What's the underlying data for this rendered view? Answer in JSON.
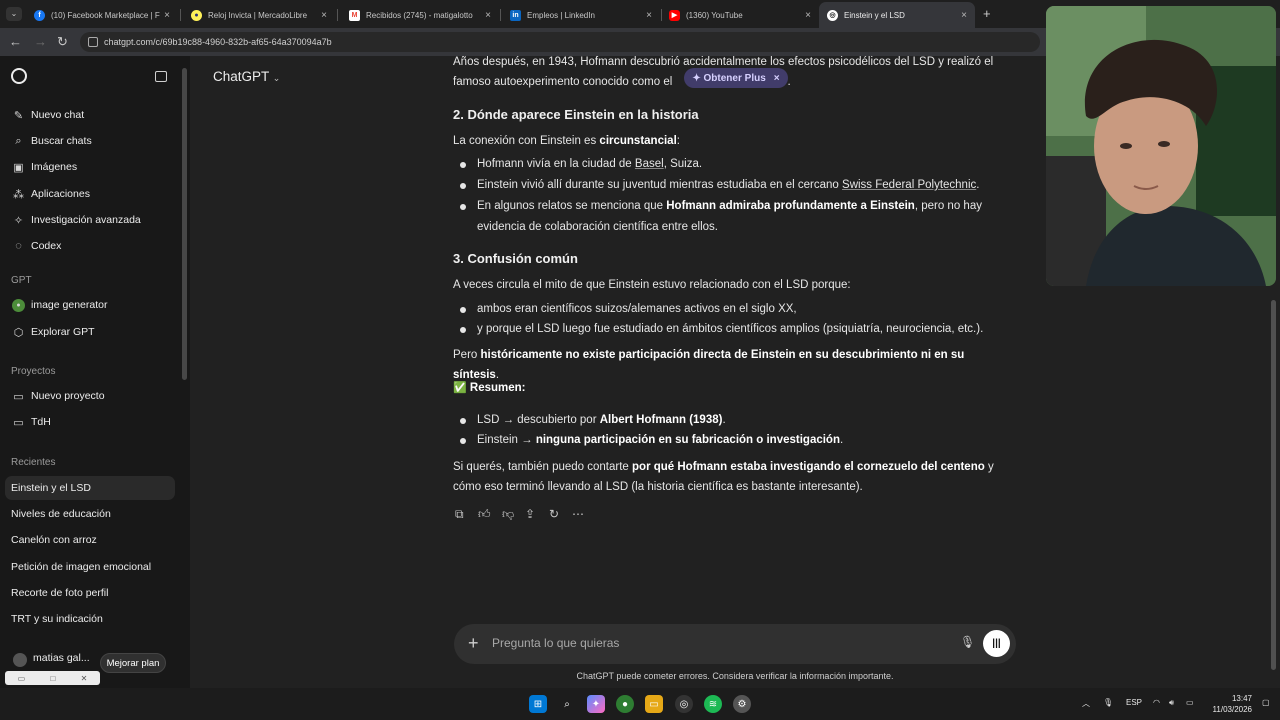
{
  "browser": {
    "tabs": [
      {
        "title": "(10) Facebook Marketplace | Fa",
        "icon": "facebook-icon",
        "color": "#1877f2",
        "glyph": "f"
      },
      {
        "title": "Reloj Invicta | MercadoLibre",
        "icon": "mercadolibre-icon",
        "color": "#fff159",
        "glyph": "●"
      },
      {
        "title": "Recibidos (2745) - matigalotto",
        "icon": "gmail-icon",
        "color": "#ea4335",
        "glyph": "M"
      },
      {
        "title": "Empleos | LinkedIn",
        "icon": "linkedin-icon",
        "color": "#0a66c2",
        "glyph": "in"
      },
      {
        "title": "(1360) YouTube",
        "icon": "youtube-icon",
        "color": "#ff0000",
        "glyph": "▶"
      },
      {
        "title": "Einstein y el LSD",
        "icon": "chatgpt-icon",
        "color": "#ffffff",
        "glyph": "◎"
      }
    ],
    "url": "chatgpt.com/c/69b19c88-4960-832b-af65-64a370094a7b"
  },
  "sidebar": {
    "menu": [
      {
        "label": "Nuevo chat",
        "icon": "edit-icon",
        "glyph": "✎"
      },
      {
        "label": "Buscar chats",
        "icon": "search-icon",
        "glyph": "⌕"
      },
      {
        "label": "Imágenes",
        "icon": "image-icon",
        "glyph": "▣"
      },
      {
        "label": "Aplicaciones",
        "icon": "apps-icon",
        "glyph": "⁂"
      },
      {
        "label": "Investigación avanzada",
        "icon": "research-icon",
        "glyph": "✧"
      },
      {
        "label": "Codex",
        "icon": "codex-icon",
        "glyph": "◌"
      }
    ],
    "gpt_heading": "GPT",
    "gpts": [
      {
        "label": "image generator",
        "icon": "image-generator-icon",
        "glyph": "●"
      },
      {
        "label": "Explorar GPT",
        "icon": "explore-icon",
        "glyph": "⬡"
      }
    ],
    "projects_heading": "Proyectos",
    "projects": [
      {
        "label": "Nuevo proyecto",
        "icon": "folder-plus-icon",
        "glyph": "▭"
      },
      {
        "label": "TdH",
        "icon": "folder-icon",
        "glyph": "▭"
      }
    ],
    "recent_heading": "Recientes",
    "recents": [
      "Einstein y el LSD",
      "Niveles de educación",
      "Canelón con arroz",
      "Petición de imagen emocional",
      "Recorte de foto perfil",
      "TRT y su indicación"
    ],
    "user_name": "matias gal...",
    "upgrade_label": "Mejorar plan"
  },
  "header": {
    "model": "ChatGPT",
    "plus_label": "Obtener Plus"
  },
  "message": {
    "intro_1": "Años después, en 1943, Hofmann descubrió accidentalmente los efectos psicodélicos del LSD y realizó el",
    "intro_2": "famoso autoexperimento conocido como el",
    "intro_end": ".",
    "h2": "2. Dónde aparece Einstein en la historia",
    "conn_a": "La conexión con Einstein es",
    "conn_b": "circunstancial",
    "conn_c": ":",
    "b1_a": "Hofmann vivía en la ciudad de",
    "b1_b": "Basel",
    "b1_c": ", Suiza.",
    "b2_a": "Einstein vivió allí durante su juventud mientras estudiaba en el cercano",
    "b2_b": "Swiss Federal Polytechnic",
    "b2_c": ".",
    "b3_a": "En algunos relatos se menciona que",
    "b3_b": "Hofmann admiraba profundamente a Einstein",
    "b3_c": ", pero no hay",
    "b3_d": "evidencia de colaboración científica entre ellos.",
    "h3": "3. Confusión común",
    "myth": "A veces circula el mito de que Einstein estuvo relacionado con el LSD porque:",
    "c1": "ambos eran científicos suizos/alemanes activos en el siglo XX,",
    "c2": "y porque el LSD luego fue estudiado en ámbitos científicos amplios (psiquiatría, neurociencia, etc.).",
    "hist_a": "Pero",
    "hist_b": "históricamente no existe participación directa de Einstein en su descubrimiento ni en su síntesis",
    "hist_c": ".",
    "summary_check": "✅",
    "summary": "Resumen:",
    "s1_a": "LSD → descubierto por",
    "s1_b": "Albert Hofmann (1938)",
    "s1_c": ".",
    "s2_a": "Einstein →",
    "s2_b": "ninguna participación en su fabricación o investigación",
    "s2_c": ".",
    "end_a": "Si querés, también puedo contarte",
    "end_b": "por qué Hofmann estaba investigando el cornezuelo del centeno",
    "end_c": "y",
    "end_d": "cómo eso terminó llevando al LSD (la historia científica es bastante interesante)."
  },
  "composer": {
    "placeholder": "Pregunta lo que quieras"
  },
  "disclaimer": "ChatGPT puede cometer errores. Considera verificar la información importante.",
  "taskbar": {
    "lang": "ESP",
    "time": "13:47",
    "date": "11/03/2026"
  },
  "colors": {
    "background": "#212121",
    "sidebar": "#181818",
    "plus_pill": "#413c6a"
  }
}
